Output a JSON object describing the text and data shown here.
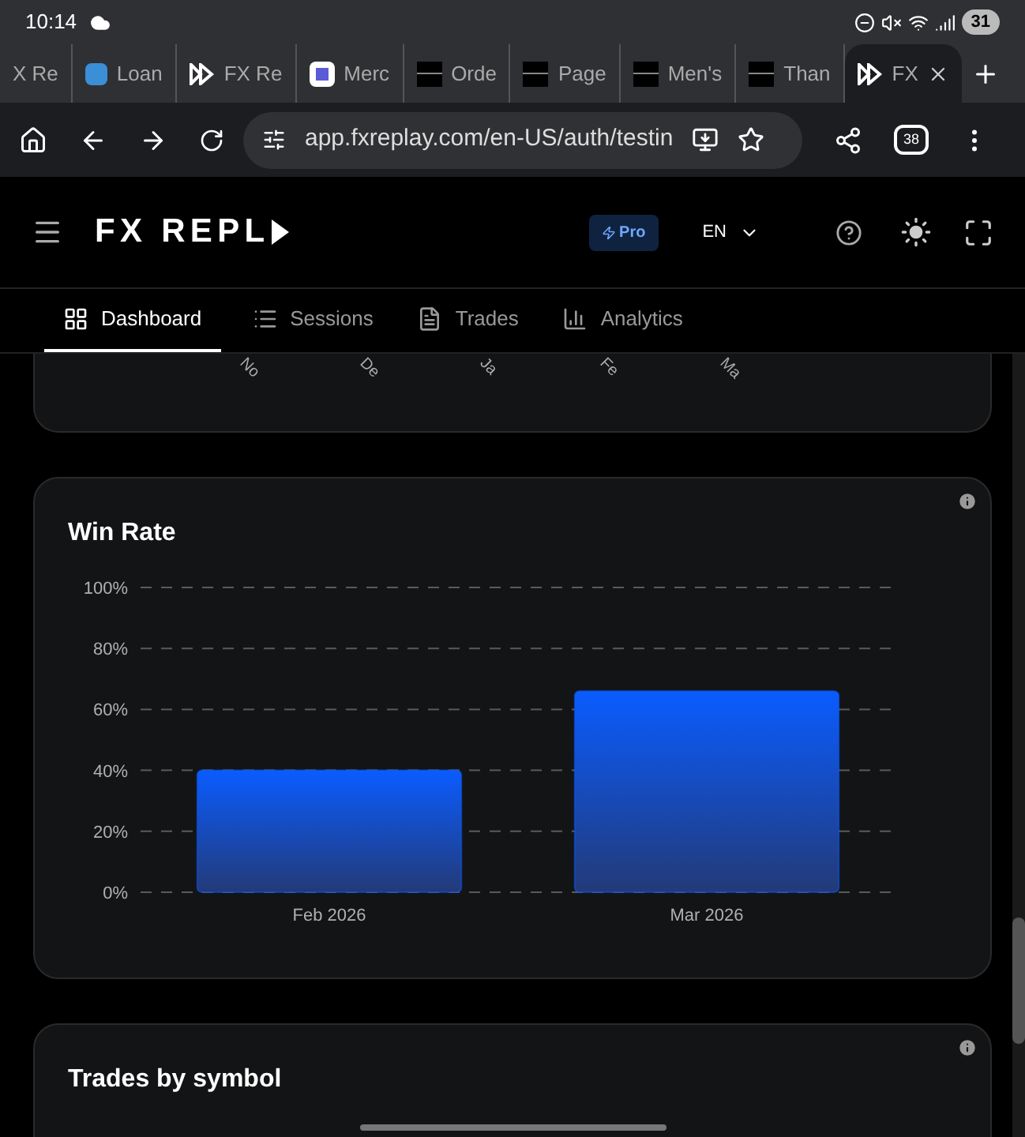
{
  "status_bar": {
    "time": "10:14",
    "battery": "31"
  },
  "browser_tabs": [
    {
      "label": "X Re",
      "selected": false,
      "kind": "none"
    },
    {
      "label": "Loan",
      "selected": false,
      "kind": "bank"
    },
    {
      "label": "FX Re",
      "selected": false,
      "kind": "fx"
    },
    {
      "label": "Merc",
      "selected": false,
      "kind": "m"
    },
    {
      "label": "Orde",
      "selected": false,
      "kind": "dark"
    },
    {
      "label": "Page",
      "selected": false,
      "kind": "dark"
    },
    {
      "label": "Men's",
      "selected": false,
      "kind": "dark"
    },
    {
      "label": "Than",
      "selected": false,
      "kind": "dark"
    },
    {
      "label": "FX",
      "selected": true,
      "kind": "fx"
    }
  ],
  "address_bar": {
    "url": "app.fxreplay.com/en-US/auth/testin",
    "tab_count": "38"
  },
  "header": {
    "logo": "FX REPL",
    "badge": "Pro",
    "language": "EN"
  },
  "nav_tabs": [
    {
      "label": "Dashboard",
      "selected": true,
      "kind": "grid"
    },
    {
      "label": "Sessions",
      "selected": false,
      "kind": "list"
    },
    {
      "label": "Trades",
      "selected": false,
      "kind": "doc"
    },
    {
      "label": "Analytics",
      "selected": false,
      "kind": "chart"
    }
  ],
  "previous_chart": {
    "axis_labels": [
      "No",
      "De",
      "Ja",
      "Fe",
      "Ma"
    ]
  },
  "win_rate": {
    "title": "Win Rate",
    "chart_data": {
      "type": "bar",
      "categories": [
        "Feb 2026",
        "Mar 2026"
      ],
      "series": [
        {
          "color": "#0a5cff",
          "values": [
            40,
            66
          ]
        }
      ],
      "grid": true,
      "ylim": [
        0,
        100
      ],
      "yticks": [
        {
          "value": 0,
          "label": "0%"
        },
        {
          "value": 20,
          "label": "20%"
        },
        {
          "value": 40,
          "label": "40%"
        },
        {
          "value": 60,
          "label": "60%"
        },
        {
          "value": 80,
          "label": "80%"
        },
        {
          "value": 100,
          "label": "100%"
        }
      ]
    }
  },
  "trades_by_symbol": {
    "title": "Trades by symbol"
  }
}
